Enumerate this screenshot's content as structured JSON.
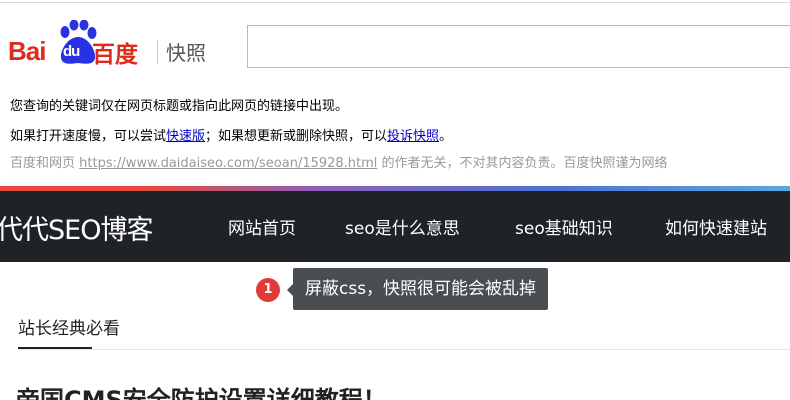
{
  "snapshot": {
    "logo": {
      "latin_bai": "Bai",
      "latin_du": "du",
      "cn_name": "百度",
      "snapshot_label": "快照"
    },
    "search": {
      "value": ""
    },
    "notice_line1": "您查询的关键词仅在网页标题或指向此网页的链接中出现。",
    "notice_line2": {
      "part1": "如果打开速度慢，可以尝试",
      "fast_link": "快速版",
      "part2": "；如果想更新或删除快照，可以",
      "complain_link": "投诉快照",
      "part3": "。"
    },
    "notice_line3": {
      "part1": "百度和网页 ",
      "url": "https://www.daidaiseo.com/seoan/15928.html",
      "part2": " 的作者无关，不对其内容负责。百度快照谨为网络"
    }
  },
  "blog": {
    "site_title": "代代SEO博客",
    "nav": [
      "网站首页",
      "seo是什么意思",
      "seo基础知识",
      "如何快速建站"
    ]
  },
  "tooltip": {
    "badge": "1",
    "text": "屏蔽css，快照很可能会被乱掉"
  },
  "section": {
    "tab": "站长经典必看",
    "article_title": "帝国CMS安全防护设置详细教程！"
  },
  "colors": {
    "baidu_red": "#de2b1a",
    "baidu_blue": "#2932e1",
    "nav_bg": "#1f2327",
    "tooltip_bg": "#4a4d52",
    "badge_red": "#e03a3a",
    "link_blue": "#0000cc"
  }
}
